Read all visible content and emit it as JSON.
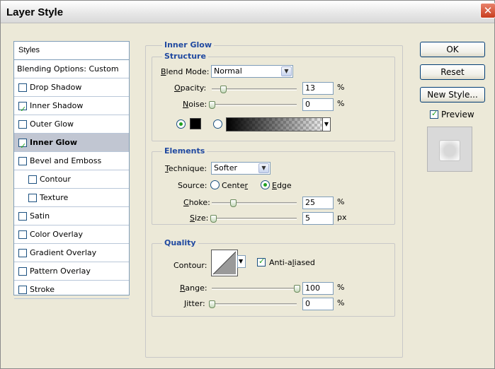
{
  "window": {
    "title": "Layer Style",
    "close_glyph": "✕"
  },
  "styles_panel": {
    "header": "Styles",
    "items": [
      {
        "label": "Blending Options: Custom",
        "checkbox": false,
        "checked": false,
        "indent": false,
        "selected": false
      },
      {
        "label": "Drop Shadow",
        "checkbox": true,
        "checked": false,
        "indent": false,
        "selected": false
      },
      {
        "label": "Inner Shadow",
        "checkbox": true,
        "checked": true,
        "indent": false,
        "selected": false
      },
      {
        "label": "Outer Glow",
        "checkbox": true,
        "checked": false,
        "indent": false,
        "selected": false
      },
      {
        "label": "Inner Glow",
        "checkbox": true,
        "checked": true,
        "indent": false,
        "selected": true
      },
      {
        "label": "Bevel and Emboss",
        "checkbox": true,
        "checked": false,
        "indent": false,
        "selected": false
      },
      {
        "label": "Contour",
        "checkbox": true,
        "checked": false,
        "indent": true,
        "selected": false
      },
      {
        "label": "Texture",
        "checkbox": true,
        "checked": false,
        "indent": true,
        "selected": false
      },
      {
        "label": "Satin",
        "checkbox": true,
        "checked": false,
        "indent": false,
        "selected": false
      },
      {
        "label": "Color Overlay",
        "checkbox": true,
        "checked": false,
        "indent": false,
        "selected": false
      },
      {
        "label": "Gradient Overlay",
        "checkbox": true,
        "checked": false,
        "indent": false,
        "selected": false
      },
      {
        "label": "Pattern Overlay",
        "checkbox": true,
        "checked": false,
        "indent": false,
        "selected": false
      },
      {
        "label": "Stroke",
        "checkbox": true,
        "checked": false,
        "indent": false,
        "selected": false
      }
    ]
  },
  "inner_glow": {
    "title": "Inner Glow",
    "structure": {
      "title": "Structure",
      "blend_mode_label": "Blend Mode:",
      "blend_mode_value": "Normal",
      "opacity_label": "Opacity:",
      "opacity_value": "13",
      "opacity_unit": "%",
      "opacity_fraction": 0.13,
      "noise_label": "Noise:",
      "noise_value": "0",
      "noise_unit": "%",
      "noise_fraction": 0.0,
      "color_mode": "solid",
      "swatch_color": "#000000"
    },
    "elements": {
      "title": "Elements",
      "technique_label": "Technique:",
      "technique_value": "Softer",
      "source_label": "Source:",
      "source_center": "Center",
      "source_edge": "Edge",
      "source_selected": "Edge",
      "choke_label": "Choke:",
      "choke_value": "25",
      "choke_unit": "%",
      "choke_fraction": 0.25,
      "size_label": "Size:",
      "size_value": "5",
      "size_unit": "px",
      "size_fraction": 0.02
    },
    "quality": {
      "title": "Quality",
      "contour_label": "Contour:",
      "anti_aliased_label": "Anti-aliased",
      "anti_aliased_checked": true,
      "range_label": "Range:",
      "range_value": "100",
      "range_unit": "%",
      "range_fraction": 1.0,
      "jitter_label": "Jitter:",
      "jitter_value": "0",
      "jitter_unit": "%",
      "jitter_fraction": 0.0
    }
  },
  "buttons": {
    "ok": "OK",
    "reset": "Reset",
    "new_style": "New Style...",
    "preview_label": "Preview",
    "preview_checked": true
  },
  "icons": {
    "checkbox_tick": "✓",
    "dropdown_arrow": "▼"
  },
  "colors": {
    "dialog_bg": "#ece9d8",
    "section_title": "#2049a0",
    "selected_row": "#c1c6d2",
    "check_green": "#21a121"
  }
}
